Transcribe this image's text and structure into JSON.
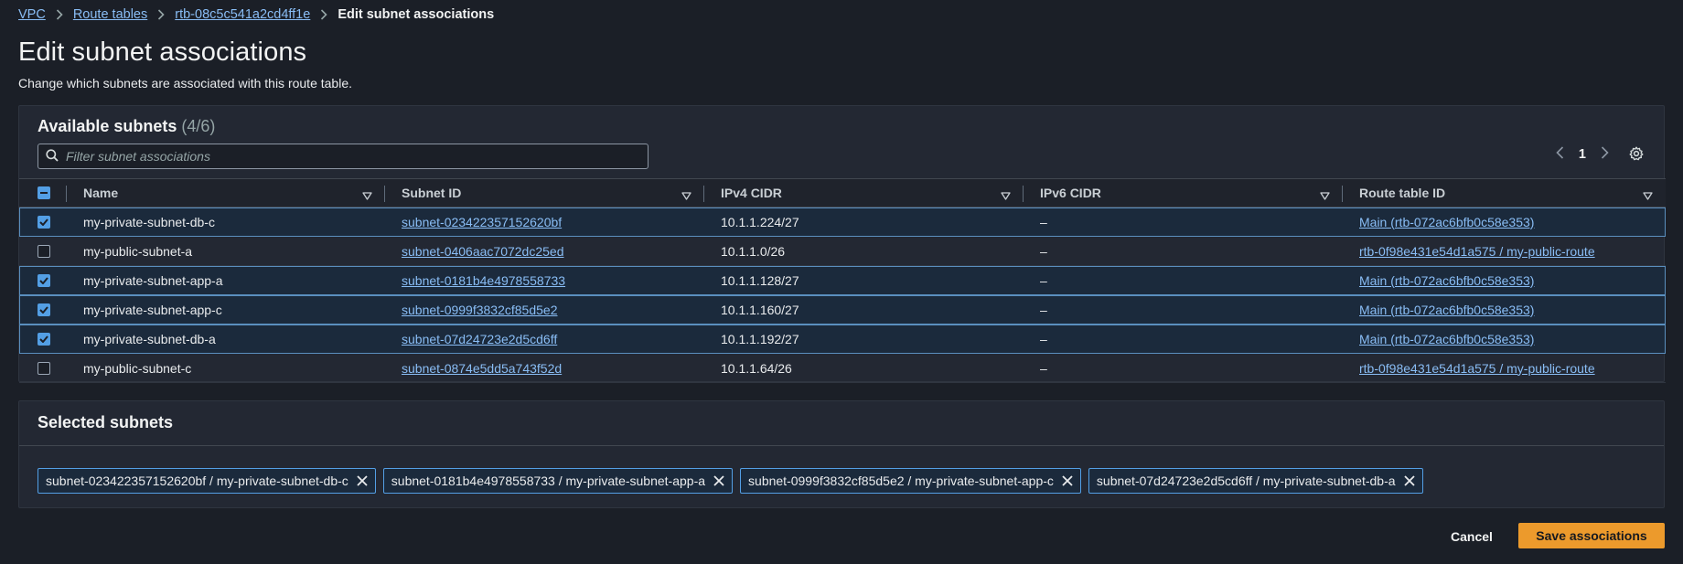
{
  "breadcrumb": {
    "items": [
      "VPC",
      "Route tables",
      "rtb-08c5c541a2cd4ff1e"
    ],
    "current": "Edit subnet associations"
  },
  "page": {
    "title": "Edit subnet associations",
    "description": "Change which subnets are associated with this route table."
  },
  "available": {
    "title": "Available subnets",
    "count": "(4/6)",
    "filter_placeholder": "Filter subnet associations",
    "page_number": "1",
    "columns": [
      "Name",
      "Subnet ID",
      "IPv4 CIDR",
      "IPv6 CIDR",
      "Route table ID"
    ],
    "rows": [
      {
        "selected": true,
        "name": "my-private-subnet-db-c",
        "subnet_id": "subnet-023422357152620bf",
        "ipv4": "10.1.1.224/27",
        "ipv6": "–",
        "route_table": "Main (rtb-072ac6bfb0c58e353)"
      },
      {
        "selected": false,
        "name": "my-public-subnet-a",
        "subnet_id": "subnet-0406aac7072dc25ed",
        "ipv4": "10.1.1.0/26",
        "ipv6": "–",
        "route_table": "rtb-0f98e431e54d1a575 / my-public-route"
      },
      {
        "selected": true,
        "name": "my-private-subnet-app-a",
        "subnet_id": "subnet-0181b4e4978558733",
        "ipv4": "10.1.1.128/27",
        "ipv6": "–",
        "route_table": "Main (rtb-072ac6bfb0c58e353)"
      },
      {
        "selected": true,
        "name": "my-private-subnet-app-c",
        "subnet_id": "subnet-0999f3832cf85d5e2",
        "ipv4": "10.1.1.160/27",
        "ipv6": "–",
        "route_table": "Main (rtb-072ac6bfb0c58e353)"
      },
      {
        "selected": true,
        "name": "my-private-subnet-db-a",
        "subnet_id": "subnet-07d24723e2d5cd6ff",
        "ipv4": "10.1.1.192/27",
        "ipv6": "–",
        "route_table": "Main (rtb-072ac6bfb0c58e353)"
      },
      {
        "selected": false,
        "name": "my-public-subnet-c",
        "subnet_id": "subnet-0874e5dd5a743f52d",
        "ipv4": "10.1.1.64/26",
        "ipv6": "–",
        "route_table": "rtb-0f98e431e54d1a575 / my-public-route"
      }
    ]
  },
  "selected": {
    "title": "Selected subnets",
    "tokens": [
      "subnet-023422357152620bf / my-private-subnet-db-c",
      "subnet-0181b4e4978558733 / my-private-subnet-app-a",
      "subnet-0999f3832cf85d5e2 / my-private-subnet-app-c",
      "subnet-07d24723e2d5cd6ff / my-private-subnet-db-a"
    ]
  },
  "actions": {
    "cancel": "Cancel",
    "save": "Save associations"
  },
  "colors": {
    "background": "#1b1f27",
    "panel": "#232833",
    "link": "#89bdf5",
    "accent": "#539fe5",
    "primary_button": "#ec9a2c"
  },
  "icons": {
    "search": "search-icon",
    "prev": "chevron-left-icon",
    "next": "chevron-right-icon",
    "settings": "gear-icon",
    "sort": "caret-down-icon",
    "remove": "close-icon"
  }
}
